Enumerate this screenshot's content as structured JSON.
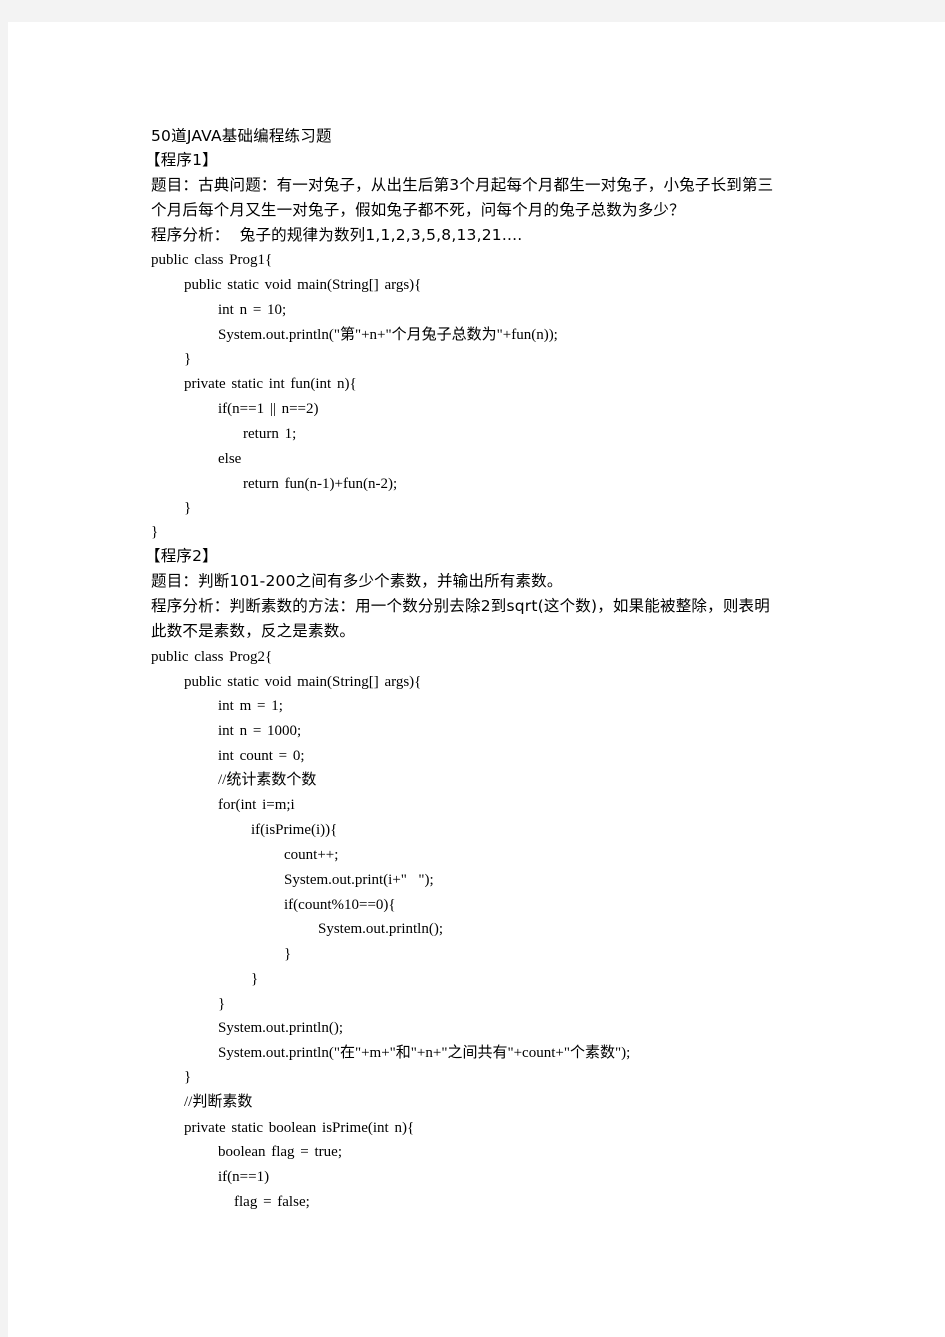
{
  "document": {
    "title": "50道JAVA基础编程练习题",
    "programs": [
      {
        "heading": "【程序1】",
        "problem_lines": [
          "题目：古典问题：有一对兔子，从出生后第3个月起每个月都生一对兔子，小兔子长到第三",
          "个月后每个月又生一对兔子，假如兔子都不死，问每个月的兔子总数为多少？"
        ],
        "analysis_lines": [
          "程序分析：  兔子的规律为数列1,1,2,3,5,8,13,21...."
        ],
        "code_lines": [
          "public class Prog1{",
          "public static void main(String[] args){",
          "int n = 10;",
          "System.out.println(\"第\"+n+\"个月兔子总数为\"+fun(n));",
          "}",
          "private static int fun(int n){",
          "if(n==1 || n==2)",
          "return 1;",
          "else",
          "return fun(n-1)+fun(n-2);",
          "}",
          "}"
        ]
      },
      {
        "heading": "【程序2】",
        "problem_lines": [
          "题目：判断101-200之间有多少个素数，并输出所有素数。"
        ],
        "analysis_lines": [
          "程序分析：判断素数的方法：用一个数分别去除2到sqrt(这个数)，如果能被整除，则表明",
          "此数不是素数，反之是素数。"
        ],
        "code_lines": [
          "public class Prog2{",
          "public static void main(String[] args){",
          "int m = 1;",
          "int n = 1000;",
          "int count = 0;",
          "//统计素数个数",
          "for(int i=m;i",
          "if(isPrime(i)){",
          "count++;",
          "System.out.print(i+\"  \");",
          "if(count%10==0){",
          "System.out.println();",
          "}",
          "}",
          "}",
          "System.out.println();",
          "System.out.println(\"在\"+m+\"和\"+n+\"之间共有\"+count+\"个素数\");",
          "}",
          "//判断素数",
          "private static boolean isPrime(int n){",
          "boolean flag = true;",
          "if(n==1)",
          "flag = false;"
        ]
      }
    ]
  }
}
